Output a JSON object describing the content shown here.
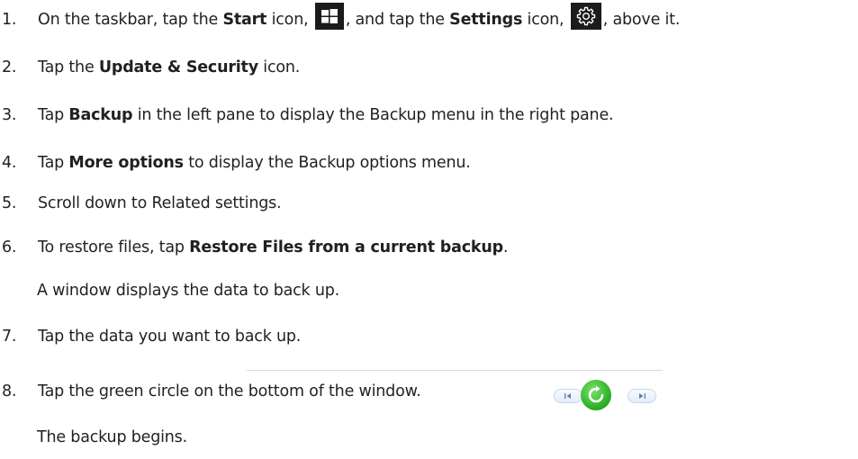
{
  "steps": [
    {
      "num": "1.",
      "pre": "On the taskbar, tap the ",
      "b1": "Start",
      "mid1": " icon, ",
      "mid2": ", and tap the ",
      "b2": "Settings",
      "mid3": " icon, ",
      "post": ", above it."
    },
    {
      "num": "2.",
      "pre": "Tap the ",
      "b1": "Update & Security",
      "post": " icon."
    },
    {
      "num": "3.",
      "pre": "Tap ",
      "b1": "Backup",
      "post": " in the left pane to display the Backup menu in the right pane."
    },
    {
      "num": "4.",
      "pre": "Tap ",
      "b1": "More options",
      "post": " to display the Backup options menu."
    },
    {
      "num": "5.",
      "text": "Scroll down to Related settings."
    },
    {
      "num": "6.",
      "pre": "To restore files, tap ",
      "b1": "Restore Files from a current backup",
      "post": "."
    },
    {
      "num": "7.",
      "text": "Tap the data you want to back up."
    },
    {
      "num": "8.",
      "text": "Tap the green circle on the bottom of the window."
    }
  ],
  "notes": {
    "step6": "A window displays the data to back up.",
    "step8": "The backup begins."
  },
  "icons": {
    "start": "windows-start-icon",
    "settings": "settings-gear-icon",
    "prev": "skip-previous-icon",
    "start_backup": "green-circle-refresh-icon",
    "next": "skip-next-icon"
  },
  "colors": {
    "text": "#231f20",
    "icon_bg": "#1b1b1b",
    "green": "#2fb52c"
  }
}
